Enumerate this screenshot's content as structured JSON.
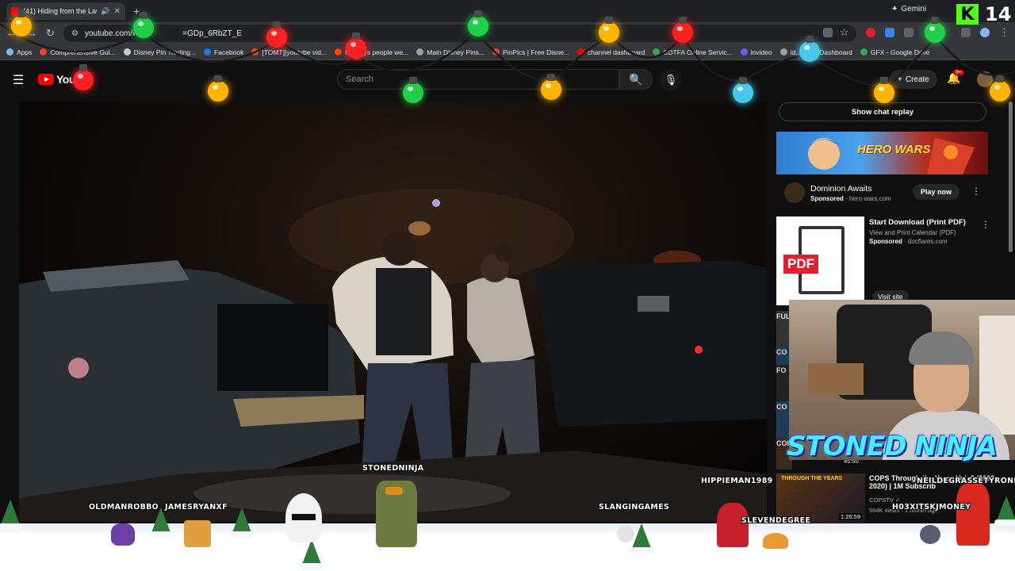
{
  "browser": {
    "tab_title": "(41) Hiding from the Law | Y",
    "new_tab_symbol": "+",
    "gemini_label": "Gemini",
    "url": "youtube.com/w",
    "url_tail": "=GDp_6RbZT_E",
    "bookmarks": [
      {
        "label": "Apps",
        "color": "#8ab4f8"
      },
      {
        "label": "Comprehensive Gui...",
        "color": "#e94235"
      },
      {
        "label": "Disney Pin Trading...",
        "color": "#cccccc"
      },
      {
        "label": "Facebook",
        "color": "#1877f2"
      },
      {
        "label": "[TOMT][youtube vid...",
        "color": "#ff4500"
      },
      {
        "label": "If todays people we...",
        "color": "#ff4500"
      },
      {
        "label": "Main Disney Pins...",
        "color": "#9aa0a6"
      },
      {
        "label": "PinPics | Free Disne...",
        "color": "#e94235"
      },
      {
        "label": "channel dashboard",
        "color": "#ff0000"
      },
      {
        "label": "CDTFA Online Servic...",
        "color": "#34a853"
      },
      {
        "label": "invideo",
        "color": "#6d5dfc"
      },
      {
        "label": "id...",
        "color": "#9aa0a6"
      },
      {
        "label": "Dashboard",
        "color": "#cccccc"
      },
      {
        "label": "GFX - Google Drive",
        "color": "#34a853"
      }
    ]
  },
  "stream_overlay": {
    "kick_logo": "K",
    "viewer_count": "14",
    "streamer_title": "STONED NINJA",
    "usernames": {
      "u1": "OLDMANROBBO",
      "u2": "JAMESRYANXF",
      "u3": "STONEDNINJA",
      "u4": "SLANGINGAMES",
      "u5": "HIPPIEMAN1989",
      "u6": "SLEVENDEGREE",
      "u7": "NEILDEGRASSETYRONE",
      "u8": "H03XITSKJMONEY"
    },
    "light_colors": [
      "#ffb400",
      "#21d04a",
      "#ff2020",
      "#48c8ec"
    ]
  },
  "youtube": {
    "logo_text": "YouT",
    "search_placeholder": "Search",
    "create_label": "Create",
    "notif_badge": "9+",
    "show_chat_replay": "Show chat replay",
    "ad1": {
      "banner_logo": "HERO WARS",
      "title": "Dominion Awaits",
      "sponsored": "Sponsored",
      "domain": "· hero-wars.com",
      "cta": "Play now"
    },
    "ad2": {
      "thumb_tag": "PDF",
      "title": "Start Download (Print PDF)",
      "subtitle": "View and Print Calendar (PDF)",
      "sponsored": "Sponsored",
      "domain": "· docflares.com",
      "cta": "Visit site"
    },
    "partial_recs": [
      "FUL",
      "CO",
      "FO",
      "CO",
      "COP"
    ],
    "rec_duration_1": "45:50",
    "rec4": {
      "thumb_text": "THROUGH THE YEARS",
      "title": "COPS Through the Years Vol. 2 (2008–2020) | 1M Subscrib",
      "channel": "COPSTV ✓",
      "views": "564K views · 1 month ago",
      "duration": "1:26:59"
    }
  }
}
